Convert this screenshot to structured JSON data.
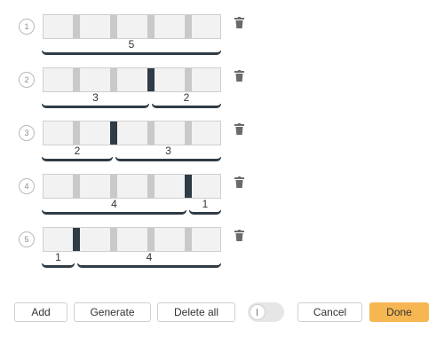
{
  "rows": [
    {
      "number": "1",
      "groups": [
        "5"
      ]
    },
    {
      "number": "2",
      "groups": [
        "3",
        "2"
      ]
    },
    {
      "number": "3",
      "groups": [
        "2",
        "3"
      ]
    },
    {
      "number": "4",
      "groups": [
        "4",
        "1"
      ]
    },
    {
      "number": "5",
      "groups": [
        "1",
        "4"
      ]
    }
  ],
  "icons": {
    "delete_row": "trash-icon"
  },
  "toolbar": {
    "add_label": "Add",
    "generate_label": "Generate",
    "delete_all_label": "Delete all",
    "cancel_label": "Cancel",
    "done_label": "Done"
  },
  "colors": {
    "cut_slot": "#2f3b45",
    "open_slot": "#c9c9c9",
    "done_button": "#f6b753"
  }
}
